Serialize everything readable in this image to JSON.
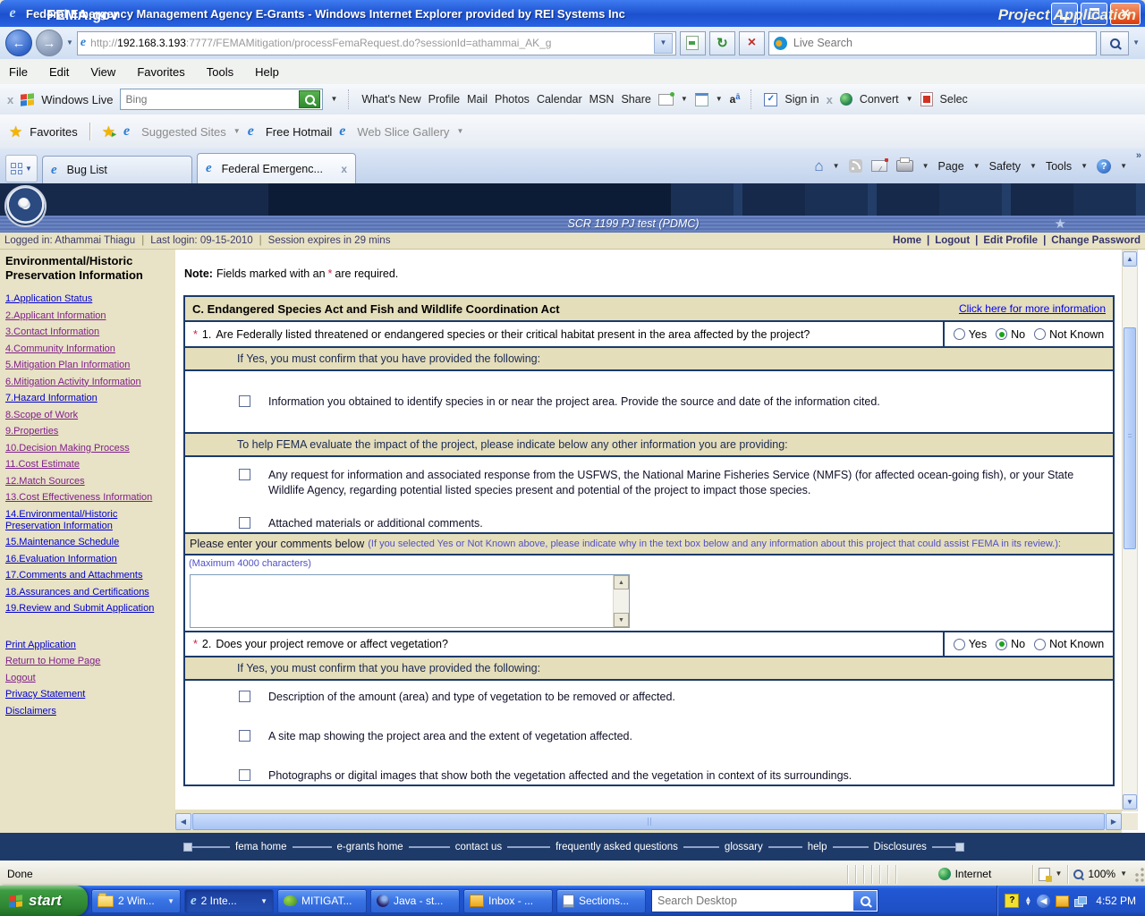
{
  "window": {
    "title": "Federal Emergency Management Agency E-Grants - Windows Internet Explorer provided by REI Systems Inc"
  },
  "browser": {
    "address": {
      "prefix": "http://",
      "domain": "192.168.3.193",
      "rest": ":7777/FEMAMitigation/processFemaRequest.do?sessionId=athammai_AK_g"
    },
    "live_search": {
      "placeholder": "Live Search"
    },
    "menu": [
      "File",
      "Edit",
      "View",
      "Favorites",
      "Tools",
      "Help"
    ],
    "live_toolbar": {
      "brand": "Windows Live",
      "search_placeholder": "Bing",
      "links": [
        "What's New",
        "Profile",
        "Mail",
        "Photos",
        "Calendar",
        "MSN",
        "Share"
      ],
      "sign_in_label": "Sign in",
      "convert_label": "Convert",
      "select_label": "Selec"
    },
    "favorites_bar": {
      "favorites_label": "Favorites",
      "suggested_sites": "Suggested Sites",
      "free_hotmail": "Free Hotmail",
      "web_slice_gallery": "Web Slice Gallery"
    },
    "tabs": {
      "tab1": "Bug List",
      "tab2": "Federal Emergenc...",
      "tab2_close": "x"
    },
    "command_bar": {
      "page": "Page",
      "safety": "Safety",
      "tools": "Tools",
      "overflow": "»"
    },
    "status_bar": {
      "message": "Done",
      "zone": "Internet",
      "zoom": "100%"
    }
  },
  "fema": {
    "brand": "FEMA.gov",
    "page_title": "Project Application",
    "subtitle": "SCR 1199 PJ test (PDMC)",
    "session_bar": {
      "logged_in": "Logged in: Athammai Thiagu",
      "last_login": "Last login: 09-15-2010",
      "session_expires": "Session expires in 29 mins",
      "links": [
        "Home",
        "Logout",
        "Edit Profile",
        "Change Password"
      ]
    },
    "sidebar": {
      "title": "Environmental/Historic Preservation Information",
      "items": [
        {
          "label": "1.Application Status",
          "visited": false
        },
        {
          "label": "2.Applicant Information",
          "visited": true
        },
        {
          "label": "3.Contact Information",
          "visited": true
        },
        {
          "label": "4.Community Information",
          "visited": true
        },
        {
          "label": "5.Mitigation Plan Information",
          "visited": true
        },
        {
          "label": "6.Mitigation Activity Information",
          "visited": true
        },
        {
          "label": "7.Hazard Information",
          "visited": false
        },
        {
          "label": "8.Scope of Work",
          "visited": true
        },
        {
          "label": "9.Properties",
          "visited": true
        },
        {
          "label": "10.Decision Making Process",
          "visited": true
        },
        {
          "label": "11.Cost Estimate",
          "visited": true
        },
        {
          "label": "12.Match Sources",
          "visited": true
        },
        {
          "label": "13.Cost Effectiveness Information",
          "visited": true
        },
        {
          "label": "14.Environmental/Historic Preservation Information",
          "visited": false
        },
        {
          "label": "15.Maintenance Schedule",
          "visited": false
        },
        {
          "label": "16.Evaluation Information",
          "visited": false
        },
        {
          "label": "17.Comments and Attachments",
          "visited": false
        },
        {
          "label": "18.Assurances and Certifications",
          "visited": false
        },
        {
          "label": "19.Review and Submit Application",
          "visited": false
        }
      ],
      "footer_links": [
        {
          "label": "Print Application",
          "visited": false
        },
        {
          "label": "Return to Home Page",
          "visited": true
        },
        {
          "label": "Logout",
          "visited": true
        },
        {
          "label": "Privacy Statement",
          "visited": false
        },
        {
          "label": "Disclaimers",
          "visited": false
        }
      ]
    },
    "content": {
      "note_label": "Note:",
      "note_text": "Fields marked with an",
      "note_star": "*",
      "note_suffix": "are required.",
      "section": {
        "title": "C. Endangered Species Act and Fish and Wildlife Coordination Act",
        "more_info": "Click here for more information",
        "q1": {
          "star": "*",
          "number": "1.",
          "text": "Are Federally listed threatened or endangered species or their critical habitat present in the area affected by the project?",
          "options": [
            "Yes",
            "No",
            "Not Known"
          ],
          "selected": "No"
        },
        "if_yes": "If Yes, you must confirm that you have provided the following:",
        "q1_check1": "Information you obtained to identify species in or near the project area. Provide the source and date of the information cited.",
        "help_band": "To help FEMA evaluate the impact of the project, please indicate below any other information you are providing:",
        "q1_check2": "Any request for information and associated response from the USFWS, the National Marine Fisheries Service (NMFS) (for affected ocean-going fish), or your State Wildlife Agency, regarding potential listed species present and potential of the project to impact those species.",
        "q1_check3": "Attached materials or additional comments.",
        "comments_label": "Please enter your comments below",
        "comments_note": "(If you selected Yes or Not Known above, please indicate why in the text box below and any information about this project that could assist FEMA in its review.):",
        "max_chars": "(Maximum 4000 characters)",
        "comments_value": "",
        "q2": {
          "star": "*",
          "number": "2.",
          "text": "Does your project remove or affect vegetation?",
          "options": [
            "Yes",
            "No",
            "Not Known"
          ],
          "selected": "No"
        },
        "q2_check1": "Description of the amount (area) and type of vegetation to be removed or affected.",
        "q2_check2": "A site map showing the project area and the extent of vegetation affected.",
        "q2_check3": "Photographs or digital images that show both the vegetation affected and the vegetation in context of its surroundings."
      }
    },
    "footer_links": [
      "fema home",
      "e-grants home",
      "contact us",
      "frequently asked questions",
      "glossary",
      "help",
      "Disclosures"
    ]
  },
  "taskbar": {
    "start_label": "start",
    "items": [
      {
        "label": "2 Win...",
        "grouped": true
      },
      {
        "label": "2 Inte...",
        "grouped": true,
        "active": true
      },
      {
        "label": "MITIGAT...",
        "grouped": false
      },
      {
        "label": "Java - st...",
        "grouped": false
      },
      {
        "label": "Inbox - ...",
        "grouped": false
      },
      {
        "label": "Sections...",
        "grouped": false
      }
    ],
    "search_placeholder": "Search Desktop",
    "time": "4:52 PM"
  },
  "colors": {
    "accent_navy": "#1B3A6B",
    "band_tan": "#E5DEBB",
    "link_blue": "#0000CC",
    "link_visited": "#80208A",
    "radio_selected_green": "#1BA41B"
  }
}
